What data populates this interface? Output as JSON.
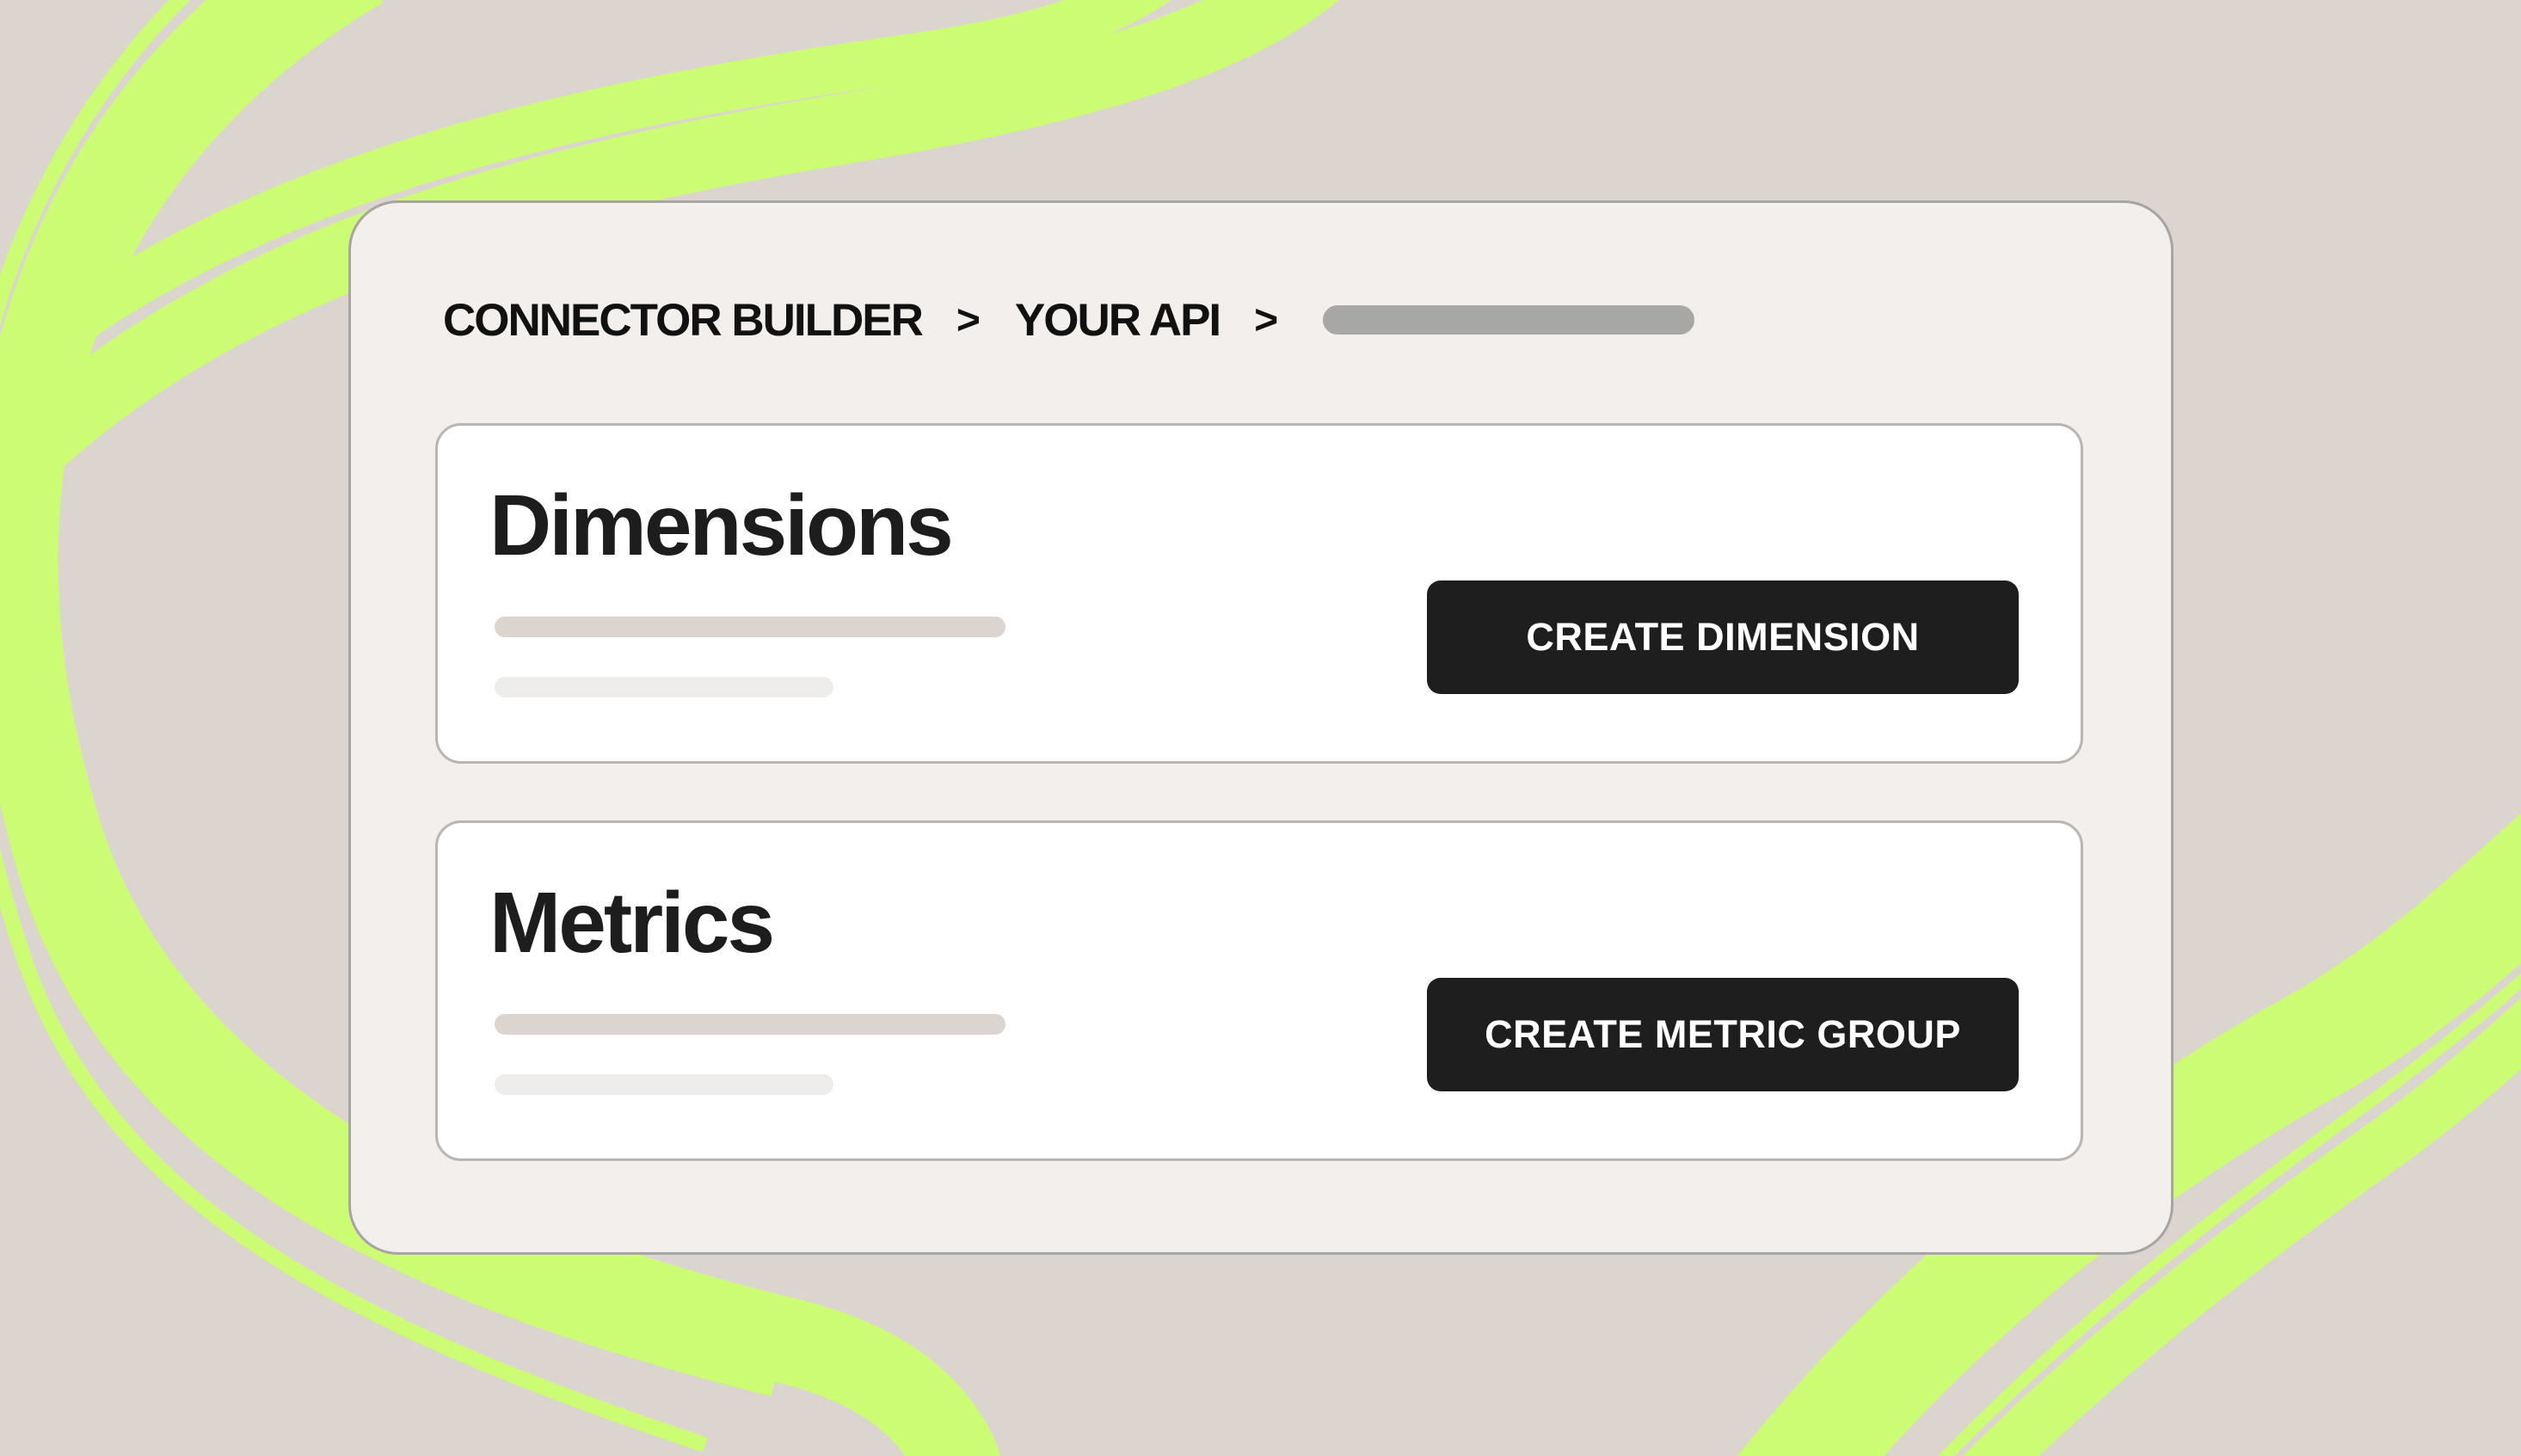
{
  "breadcrumb": {
    "items": [
      "CONNECTOR BUILDER",
      "YOUR API"
    ],
    "separator": ">"
  },
  "sections": {
    "dimensions": {
      "title": "Dimensions",
      "button_label": "CREATE DIMENSION"
    },
    "metrics": {
      "title": "Metrics",
      "button_label": "CREATE METRIC GROUP"
    }
  },
  "colors": {
    "background": "#dcd4cf",
    "accent_ribbon": "#ccfc74",
    "panel": "#f2efed",
    "card": "#ffffff",
    "button": "#1e1e1e",
    "button_text": "#ffffff"
  }
}
